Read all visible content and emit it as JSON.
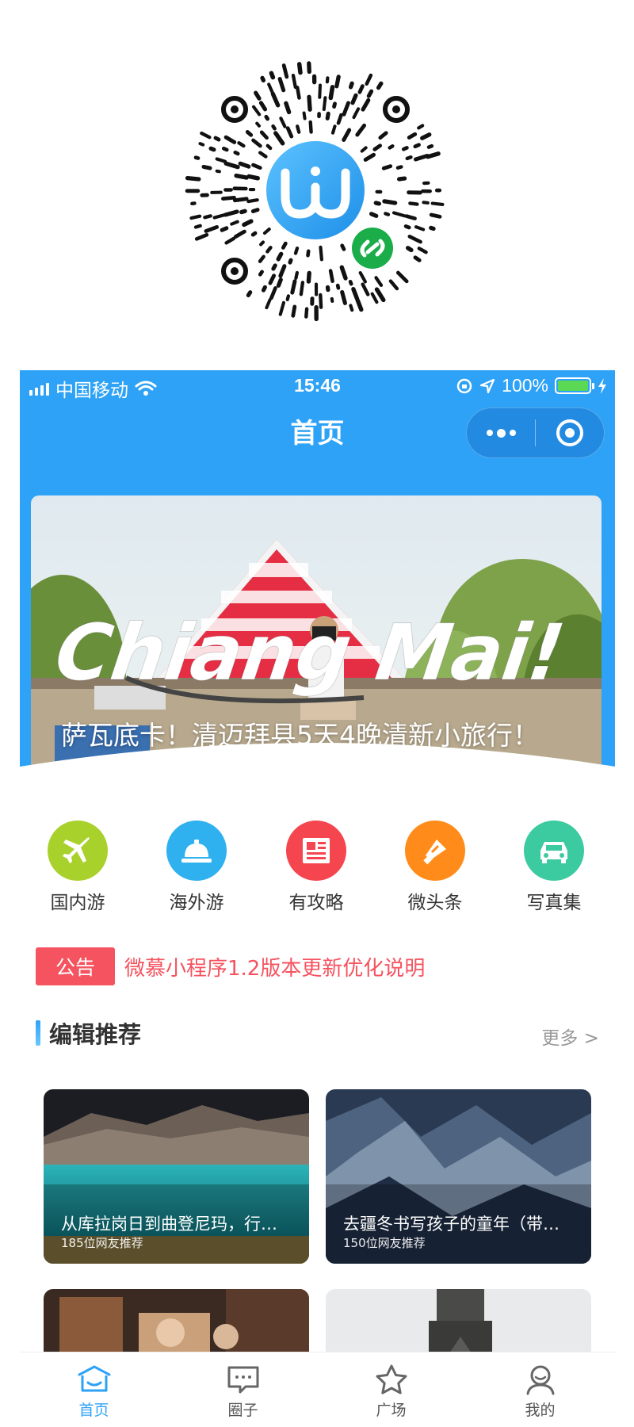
{
  "status_bar": {
    "carrier": "中国移动",
    "time": "15:46",
    "battery": "100%"
  },
  "nav": {
    "title": "首页"
  },
  "banner": {
    "overlay_text": "Chiang Mai!",
    "caption": "萨瓦底卡！清迈拜县5天4晚清新小旅行！"
  },
  "categories": [
    {
      "label": "国内游",
      "icon": "airplane-icon",
      "color": "#a9d12c"
    },
    {
      "label": "海外游",
      "icon": "service-bell-icon",
      "color": "#2eb1ee"
    },
    {
      "label": "有攻略",
      "icon": "newspaper-icon",
      "color": "#f5454e"
    },
    {
      "label": "微头条",
      "icon": "megaphone-icon",
      "color": "#ff8c1a"
    },
    {
      "label": "写真集",
      "icon": "car-icon",
      "color": "#3ccaa0"
    }
  ],
  "notice": {
    "tag": "公告",
    "text": "微慕小程序1.2版本更新优化说明"
  },
  "recommend": {
    "title": "编辑推荐",
    "more": "更多 >",
    "cards": [
      {
        "title": "从库拉岗日到曲登尼玛，行…",
        "subtitle": "185位网友推荐"
      },
      {
        "title": "去疆冬书写孩子的童年（带…",
        "subtitle": "150位网友推荐"
      },
      {
        "title": "",
        "subtitle": ""
      },
      {
        "title": "",
        "subtitle": ""
      }
    ]
  },
  "tabbar": [
    {
      "label": "首页",
      "icon": "home-icon",
      "active": true
    },
    {
      "label": "圈子",
      "icon": "chat-icon",
      "active": false
    },
    {
      "label": "广场",
      "icon": "star-icon",
      "active": false
    },
    {
      "label": "我的",
      "icon": "user-icon",
      "active": false
    }
  ],
  "colors": {
    "primary": "#2ea2f6",
    "notice": "#f5535f"
  }
}
